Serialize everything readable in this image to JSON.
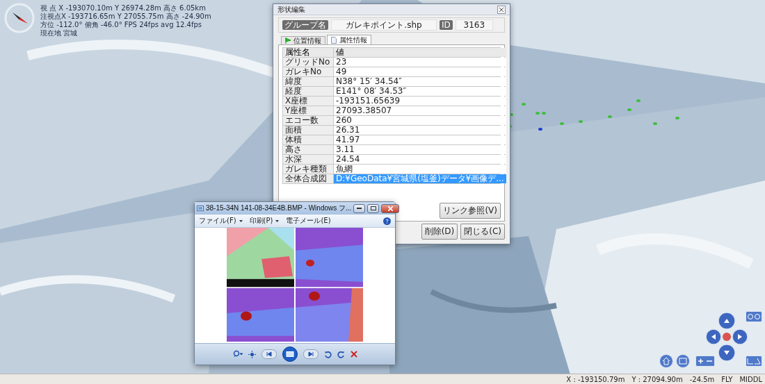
{
  "hud": {
    "lines": [
      "視 点 X -193070.10m Y 26974.28m 高さ 6.05km",
      "注視点X -193716.65m Y 27055.75m 高さ -24.90m",
      "方位 -112.0° 俯角 -46.0° FPS 24fps avg 12.4fps",
      "現在地 宮城"
    ]
  },
  "dialog": {
    "title": "形状編集",
    "group_label": "グループ名",
    "group_value": "ガレキポイント.shp",
    "id_label": "ID",
    "id_value": "3163",
    "tabs": [
      {
        "label": "位置情報",
        "selected": false
      },
      {
        "label": "属性情報",
        "selected": true
      }
    ],
    "table": {
      "columns": [
        "属性名",
        "値"
      ],
      "rows": [
        {
          "name": "グリッドNo",
          "value": "23",
          "selected": false
        },
        {
          "name": "ガレキNo",
          "value": "49",
          "selected": false
        },
        {
          "name": "緯度",
          "value": "N38° 15′ 34.54″",
          "selected": false
        },
        {
          "name": "経度",
          "value": "E141° 08′ 34.53″",
          "selected": false
        },
        {
          "name": "X座標",
          "value": "-193151.65639",
          "selected": false
        },
        {
          "name": "Y座標",
          "value": "27093.38507",
          "selected": false
        },
        {
          "name": "エコー数",
          "value": "260",
          "selected": false
        },
        {
          "name": "面積",
          "value": "26.31",
          "selected": false
        },
        {
          "name": "体積",
          "value": "41.97",
          "selected": false
        },
        {
          "name": "高さ",
          "value": "3.11",
          "selected": false
        },
        {
          "name": "水深",
          "value": "24.54",
          "selected": false
        },
        {
          "name": "ガレキ種類",
          "value": "魚網",
          "selected": false
        },
        {
          "name": "全体合成図",
          "value": "D:¥GeoData¥宮城県(塩釜)データ¥画像デ...",
          "selected": true
        }
      ]
    },
    "link_button": "リンク参照(V)",
    "buttons": [
      "削除(D)",
      "閉じる(C)"
    ]
  },
  "viewer": {
    "title": "38-15-34N 141-08-34E4B.BMP - Windows フ...",
    "menus": [
      {
        "label": "ファイル(F)",
        "dropdown": true
      },
      {
        "label": "印刷(P)",
        "dropdown": true
      },
      {
        "label": "電子メール(E)",
        "dropdown": false
      }
    ]
  },
  "status_bar": {
    "x_label": "X :",
    "x": "-193150.79m",
    "y_label": "Y :",
    "y": "27094.90m",
    "depth": "-24.5m",
    "mode": "FLY",
    "speed": "MIDDL"
  }
}
